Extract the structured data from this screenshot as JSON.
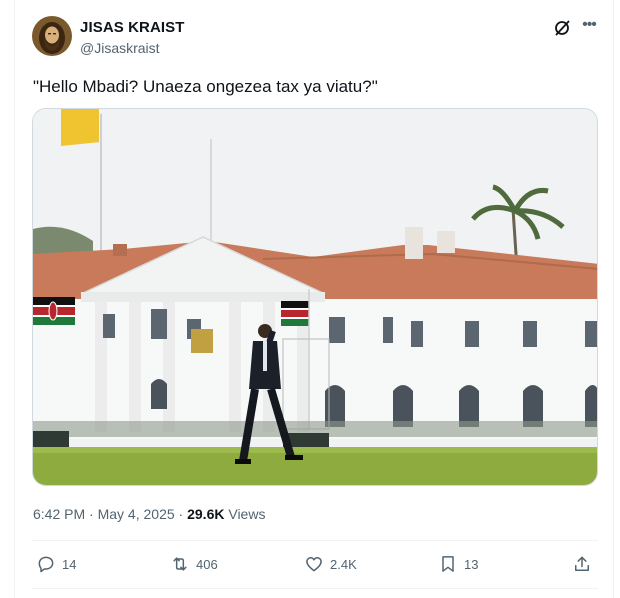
{
  "user": {
    "display_name": "JISAS KRAIST",
    "handle": "@Jisaskraist"
  },
  "tweet": {
    "text": "\"Hello Mbadi? Unaeza ongezea tax ya viatu?\"",
    "time": "6:42 PM",
    "separator_1": " · ",
    "date": "May 4, 2025",
    "separator_2": " · ",
    "views_count": "29.6K",
    "views_label": " Views"
  },
  "actions": {
    "replies": "14",
    "retweets": "406",
    "likes": "2.4K",
    "bookmarks": "13"
  },
  "icons": [
    "grok-icon",
    "more-icon",
    "reply-icon",
    "retweet-icon",
    "like-icon",
    "bookmark-icon",
    "share-icon"
  ],
  "colors": {
    "text": "#0f1419",
    "secondary": "#536471",
    "border": "#eff3f4"
  }
}
